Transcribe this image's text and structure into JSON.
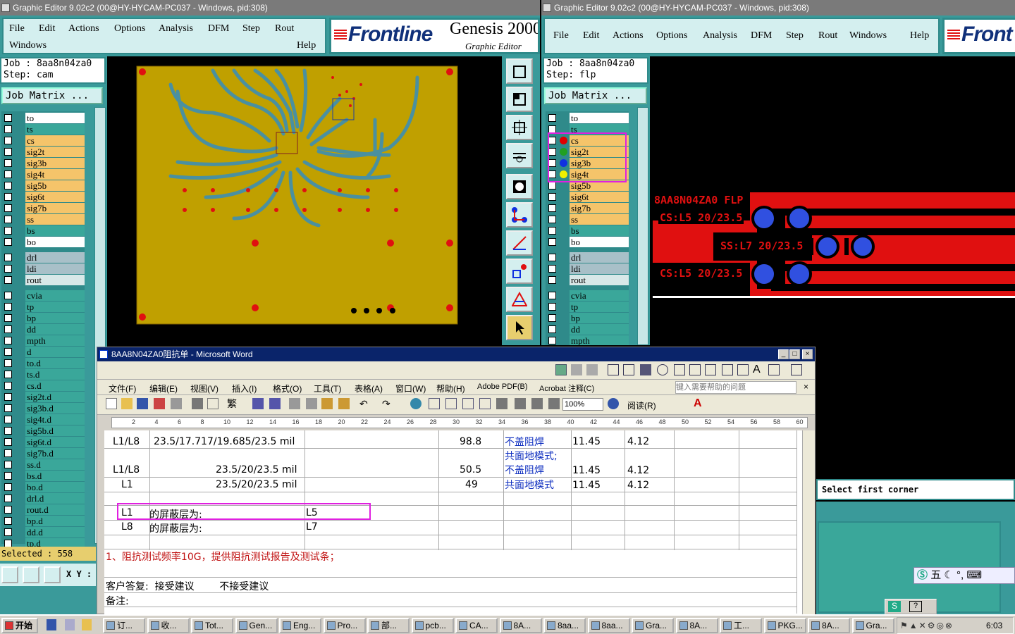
{
  "left_window": {
    "title": "Graphic Editor 9.02c2 (00@HY-HYCAM-PC037 - Windows, pid:308)",
    "menu": [
      "File",
      "Edit",
      "Actions",
      "Options",
      "Analysis",
      "DFM",
      "Step",
      "Rout",
      "Windows",
      "Help"
    ],
    "logo": "Frontline",
    "product": "Genesis 2000",
    "subtitle": "Graphic Editor",
    "job": "Job : 8aa8n04za0",
    "step": "Step: cam",
    "job_matrix": "Job Matrix ...",
    "layers": [
      {
        "name": "to",
        "color": "#ffffff"
      },
      {
        "name": "ts",
        "color": "#3aa79a"
      },
      {
        "name": "cs",
        "color": "#f5c46a"
      },
      {
        "name": "sig2t",
        "color": "#f5c46a"
      },
      {
        "name": "sig3b",
        "color": "#f5c46a"
      },
      {
        "name": "sig4t",
        "color": "#f5c46a"
      },
      {
        "name": "sig5b",
        "color": "#f5c46a"
      },
      {
        "name": "sig6t",
        "color": "#f5c46a"
      },
      {
        "name": "sig7b",
        "color": "#f5c46a"
      },
      {
        "name": "ss",
        "color": "#f5c46a"
      },
      {
        "name": "bs",
        "color": "#3aa79a"
      },
      {
        "name": "bo",
        "color": "#ffffff"
      },
      {
        "name": "drl",
        "color": "#a8c0c8"
      },
      {
        "name": "ldi",
        "color": "#a8c0c8"
      },
      {
        "name": "rout",
        "color": "#d8e8e8"
      },
      {
        "name": "cvia",
        "color": "#3aa79a"
      },
      {
        "name": "tp",
        "color": "#3aa79a"
      },
      {
        "name": "bp",
        "color": "#3aa79a"
      },
      {
        "name": "dd",
        "color": "#3aa79a"
      },
      {
        "name": "mpth",
        "color": "#3aa79a"
      },
      {
        "name": "d",
        "color": "#3aa79a"
      },
      {
        "name": "to.d",
        "color": "#3aa79a"
      },
      {
        "name": "ts.d",
        "color": "#3aa79a"
      },
      {
        "name": "cs.d",
        "color": "#3aa79a"
      },
      {
        "name": "sig2t.d",
        "color": "#3aa79a"
      },
      {
        "name": "sig3b.d",
        "color": "#3aa79a"
      },
      {
        "name": "sig4t.d",
        "color": "#3aa79a"
      },
      {
        "name": "sig5b.d",
        "color": "#3aa79a"
      },
      {
        "name": "sig6t.d",
        "color": "#3aa79a"
      },
      {
        "name": "sig7b.d",
        "color": "#3aa79a"
      },
      {
        "name": "ss.d",
        "color": "#3aa79a"
      },
      {
        "name": "bs.d",
        "color": "#3aa79a"
      },
      {
        "name": "bo.d",
        "color": "#3aa79a"
      },
      {
        "name": "drl.d",
        "color": "#3aa79a"
      },
      {
        "name": "rout.d",
        "color": "#3aa79a"
      },
      {
        "name": "bp.d",
        "color": "#3aa79a"
      },
      {
        "name": "dd.d",
        "color": "#3aa79a"
      },
      {
        "name": "tp.d",
        "color": "#3aa79a"
      }
    ],
    "selected": "Selected : 558",
    "xy": "X Y :"
  },
  "right_window": {
    "title": "Graphic Editor 9.02c2 (00@HY-HYCAM-PC037 - Windows, pid:308)",
    "menu": [
      "File",
      "Edit",
      "Actions",
      "Options",
      "Analysis",
      "DFM",
      "Step",
      "Rout",
      "Windows",
      "Help"
    ],
    "logo": "Front",
    "job": "Job : 8aa8n04za0",
    "step": "Step: flp",
    "job_matrix": "Job Matrix ...",
    "layers": [
      {
        "name": "to",
        "color": "#ffffff"
      },
      {
        "name": "ts",
        "color": "#3aa79a"
      },
      {
        "name": "cs",
        "color": "#f5c46a",
        "dot": "#e00000"
      },
      {
        "name": "sig2t",
        "color": "#f5c46a",
        "dot": "#20a020"
      },
      {
        "name": "sig3b",
        "color": "#f5c46a",
        "dot": "#1030e0"
      },
      {
        "name": "sig4t",
        "color": "#f5c46a",
        "dot": "#f0f000"
      },
      {
        "name": "sig5b",
        "color": "#f5c46a"
      },
      {
        "name": "sig6t",
        "color": "#f5c46a"
      },
      {
        "name": "sig7b",
        "color": "#f5c46a"
      },
      {
        "name": "ss",
        "color": "#f5c46a"
      },
      {
        "name": "bs",
        "color": "#3aa79a"
      },
      {
        "name": "bo",
        "color": "#ffffff"
      },
      {
        "name": "drl",
        "color": "#a8c0c8"
      },
      {
        "name": "ldi",
        "color": "#a8c0c8"
      },
      {
        "name": "rout",
        "color": "#d8e8e8"
      },
      {
        "name": "cvia",
        "color": "#3aa79a"
      },
      {
        "name": "tp",
        "color": "#3aa79a"
      },
      {
        "name": "bp",
        "color": "#3aa79a"
      },
      {
        "name": "dd",
        "color": "#3aa79a"
      },
      {
        "name": "mpth",
        "color": "#3aa79a"
      }
    ],
    "coupon_title": "8AA8N04ZA0 FLP",
    "coupon_labels": [
      "CS:L5 20/23.5",
      "SS:L7 20/23.5",
      "CS:L5 20/23.5"
    ],
    "status": "Select first corner"
  },
  "word": {
    "title": "8AA8N04ZA0阻抗单 - Microsoft Word",
    "menu": [
      "文件(F)",
      "编辑(E)",
      "视图(V)",
      "插入(I)",
      "格式(O)",
      "工具(T)",
      "表格(A)",
      "窗口(W)",
      "帮助(H)",
      "Adobe PDF(B)",
      "Acrobat 注释(C)"
    ],
    "help_placeholder": "键入需要帮助的问题",
    "zoom": "100%",
    "read_label": "阅读(R)",
    "font_label": "繁",
    "ruler": [
      "2",
      "4",
      "6",
      "8",
      "10",
      "12",
      "14",
      "16",
      "18",
      "20",
      "22",
      "24",
      "26",
      "28",
      "30",
      "32",
      "34",
      "36",
      "38",
      "40",
      "42",
      "44",
      "46",
      "48",
      "50",
      "52",
      "54",
      "56",
      "58",
      "60"
    ],
    "rows": [
      {
        "c1": "L1/L8",
        "c2": "23.5/17.717/19.685/23.5 mil",
        "c3": "98.8",
        "c4": "不盖阻焊",
        "c5": "11.45",
        "c6": "4.12"
      },
      {
        "c1": "L1/L8",
        "c2": "23.5/20/23.5 mil",
        "c3": "50.5",
        "c4a": "共面地模式;",
        "c4": "不盖阻焊",
        "c5": "11.45",
        "c6": "4.12"
      },
      {
        "c1": "L1",
        "c2": "23.5/20/23.5 mil",
        "c3": "49",
        "c4": "共面地模式",
        "c5": "11.45",
        "c6": "4.12"
      }
    ],
    "shield": [
      {
        "layer": "L1",
        "label": "的屏蔽层为:",
        "value": "L5"
      },
      {
        "layer": "L8",
        "label": "的屏蔽层为:",
        "value": "L7"
      }
    ],
    "note1": "1、阻抗测试频率10G，提供阻抗测试报告及测试条；",
    "reply": "客户答复:  接受建议        不接受建议",
    "remark": "备注:"
  },
  "ime": {
    "label": "五"
  },
  "taskbar": {
    "start": "开始",
    "clock": "6:03",
    "items": [
      "订...",
      "收...",
      "Tot...",
      "Gen...",
      "Eng...",
      "Pro...",
      "部...",
      "pcb...",
      "CA...",
      "8A...",
      "8aa...",
      "8aa...",
      "Gra...",
      "8A...",
      "工...",
      "PKG...",
      "8A...",
      "Gra..."
    ]
  }
}
